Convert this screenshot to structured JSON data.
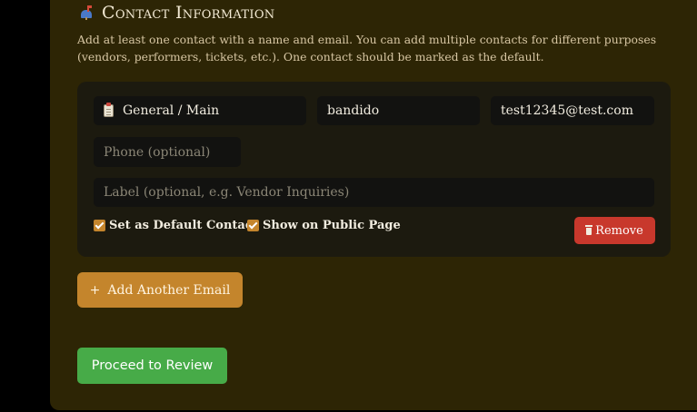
{
  "section": {
    "title": "Contact Information",
    "icon": "mailbox-icon",
    "description": "Add at least one contact with a name and email. You can add multiple contacts for different purposes (vendors, performers, tickets, etc.). One contact should be marked as the default."
  },
  "contact": {
    "type_value": "General / Main",
    "type_icon": "clipboard-icon",
    "name_value": "bandido",
    "email_value": "test12345@test.com",
    "phone_placeholder": "Phone (optional)",
    "label_placeholder": "Label (optional, e.g. Vendor Inquiries)",
    "default_checkbox_label": "Set as Default Contact",
    "default_checked": true,
    "public_checkbox_label": "Show on Public Page",
    "public_checked": true,
    "remove_label": "Remove",
    "remove_icon": "trash-icon"
  },
  "actions": {
    "add_email_plus": "+",
    "add_email_label": "Add Another Email",
    "proceed_label": "Proceed to Review"
  },
  "colors": {
    "panel_bg": "#2d2505",
    "card_bg": "#1c1a0f",
    "accent_orange": "#c4852c",
    "danger_red": "#c8382c",
    "success_green": "#47ab48"
  }
}
